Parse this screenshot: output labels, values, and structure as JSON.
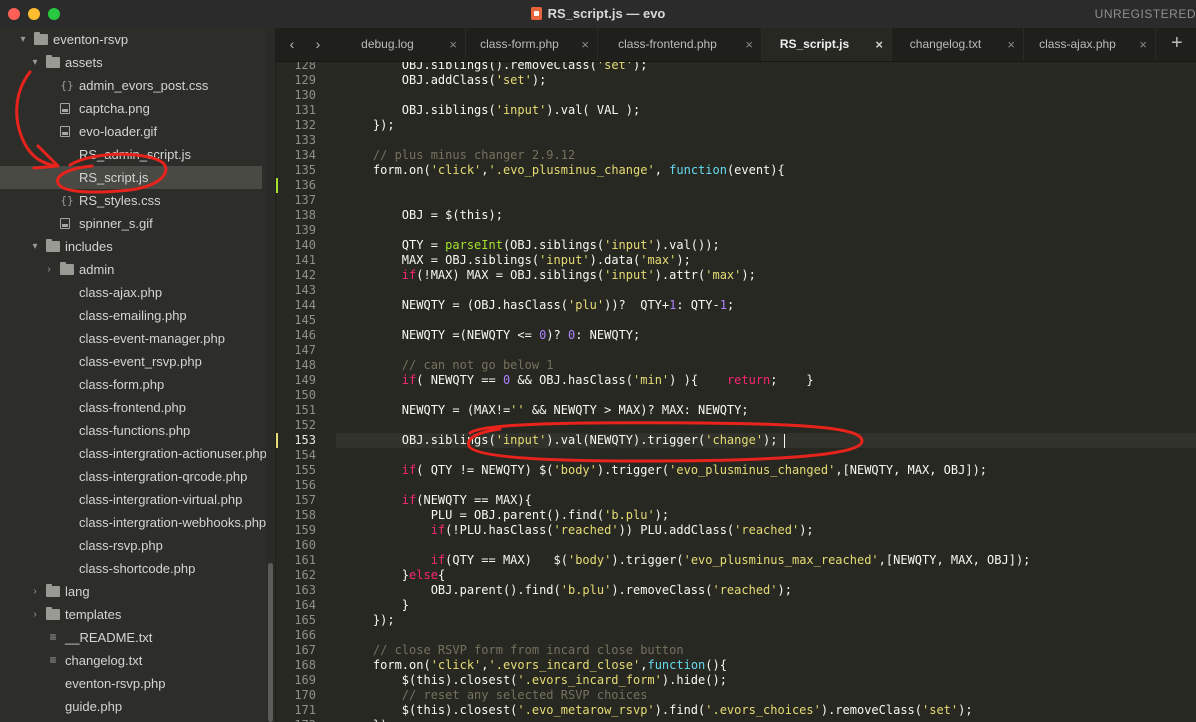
{
  "window": {
    "title": "RS_script.js — evo",
    "unregistered": "UNREGISTERED",
    "accent": "#272822"
  },
  "sidebar": {
    "items": [
      {
        "label": "eventon-rsvp",
        "kind": "folder",
        "depth": 0,
        "expanded": true
      },
      {
        "label": "assets",
        "kind": "folder",
        "depth": 1,
        "expanded": true
      },
      {
        "label": "admin_evors_post.css",
        "kind": "css",
        "depth": 2
      },
      {
        "label": "captcha.png",
        "kind": "image",
        "depth": 2
      },
      {
        "label": "evo-loader.gif",
        "kind": "image",
        "depth": 2
      },
      {
        "label": "RS_admin_script.js",
        "kind": "file",
        "depth": 2
      },
      {
        "label": "RS_script.js",
        "kind": "file",
        "depth": 2,
        "selected": true
      },
      {
        "label": "RS_styles.css",
        "kind": "css",
        "depth": 2
      },
      {
        "label": "spinner_s.gif",
        "kind": "image",
        "depth": 2
      },
      {
        "label": "includes",
        "kind": "folder",
        "depth": 1,
        "expanded": true
      },
      {
        "label": "admin",
        "kind": "folder",
        "depth": 2,
        "expanded": false
      },
      {
        "label": "class-ajax.php",
        "kind": "file",
        "depth": 2
      },
      {
        "label": "class-emailing.php",
        "kind": "file",
        "depth": 2
      },
      {
        "label": "class-event-manager.php",
        "kind": "file",
        "depth": 2
      },
      {
        "label": "class-event_rsvp.php",
        "kind": "file",
        "depth": 2
      },
      {
        "label": "class-form.php",
        "kind": "file",
        "depth": 2
      },
      {
        "label": "class-frontend.php",
        "kind": "file",
        "depth": 2
      },
      {
        "label": "class-functions.php",
        "kind": "file",
        "depth": 2
      },
      {
        "label": "class-intergration-actionuser.php",
        "kind": "file",
        "depth": 2
      },
      {
        "label": "class-intergration-qrcode.php",
        "kind": "file",
        "depth": 2
      },
      {
        "label": "class-intergration-virtual.php",
        "kind": "file",
        "depth": 2
      },
      {
        "label": "class-intergration-webhooks.php",
        "kind": "file",
        "depth": 2
      },
      {
        "label": "class-rsvp.php",
        "kind": "file",
        "depth": 2
      },
      {
        "label": "class-shortcode.php",
        "kind": "file",
        "depth": 2
      },
      {
        "label": "lang",
        "kind": "folder",
        "depth": 1,
        "expanded": false
      },
      {
        "label": "templates",
        "kind": "folder",
        "depth": 1,
        "expanded": false
      },
      {
        "label": "__README.txt",
        "kind": "text",
        "depth": 1
      },
      {
        "label": "changelog.txt",
        "kind": "text",
        "depth": 1
      },
      {
        "label": "eventon-rsvp.php",
        "kind": "file",
        "depth": 1
      },
      {
        "label": "guide.php",
        "kind": "file",
        "depth": 1
      }
    ]
  },
  "tabs": [
    {
      "label": "debug.log",
      "active": false
    },
    {
      "label": "class-form.php",
      "active": false
    },
    {
      "label": "class-frontend.php",
      "active": false
    },
    {
      "label": "RS_script.js",
      "active": true
    },
    {
      "label": "changelog.txt",
      "active": false
    },
    {
      "label": "class-ajax.php",
      "active": false
    }
  ],
  "tabbar": {
    "close_glyph": "×",
    "back_glyph": "‹",
    "forward_glyph": "›",
    "new_tab_glyph": "+"
  },
  "editor": {
    "cursor_line": 153,
    "modified_lines": [
      136,
      153
    ],
    "lines": [
      {
        "n": "128",
        "tokens": [
          [
            "",
            "        OBJ.siblings().removeClass("
          ],
          [
            "st",
            "'set'"
          ],
          [
            "",
            ");"
          ]
        ]
      },
      {
        "n": "129",
        "tokens": [
          [
            "",
            "        OBJ.addClass("
          ],
          [
            "st",
            "'set'"
          ],
          [
            "",
            ");"
          ]
        ]
      },
      {
        "n": "130",
        "tokens": []
      },
      {
        "n": "131",
        "tokens": [
          [
            "",
            "        OBJ.siblings("
          ],
          [
            "st",
            "'input'"
          ],
          [
            "",
            ").val( VAL );"
          ]
        ]
      },
      {
        "n": "132",
        "tokens": [
          [
            "",
            "    });"
          ]
        ]
      },
      {
        "n": "133",
        "tokens": []
      },
      {
        "n": "134",
        "tokens": [
          [
            "cm",
            "    // plus minus changer 2.9.12"
          ]
        ]
      },
      {
        "n": "135",
        "tokens": [
          [
            "",
            "    form.on("
          ],
          [
            "st",
            "'click'"
          ],
          [
            "",
            ","
          ],
          [
            "st",
            "'.evo_plusminus_change'"
          ],
          [
            "",
            ", "
          ],
          [
            "bi",
            "function"
          ],
          [
            "",
            "(event){"
          ]
        ]
      },
      {
        "n": "136",
        "tokens": []
      },
      {
        "n": "137",
        "tokens": []
      },
      {
        "n": "138",
        "tokens": [
          [
            "",
            "        OBJ = $(this);"
          ]
        ]
      },
      {
        "n": "139",
        "tokens": []
      },
      {
        "n": "140",
        "tokens": [
          [
            "",
            "        QTY = "
          ],
          [
            "fn",
            "parseInt"
          ],
          [
            "",
            "(OBJ.siblings("
          ],
          [
            "st",
            "'input'"
          ],
          [
            "",
            ").val());"
          ]
        ]
      },
      {
        "n": "141",
        "tokens": [
          [
            "",
            "        MAX = OBJ.siblings("
          ],
          [
            "st",
            "'input'"
          ],
          [
            "",
            ").data("
          ],
          [
            "st",
            "'max'"
          ],
          [
            "",
            ");"
          ]
        ]
      },
      {
        "n": "142",
        "tokens": [
          [
            "",
            "        "
          ],
          [
            "kw",
            "if"
          ],
          [
            "",
            "(!MAX) MAX = OBJ.siblings("
          ],
          [
            "st",
            "'input'"
          ],
          [
            "",
            ").attr("
          ],
          [
            "st",
            "'max'"
          ],
          [
            "",
            ");"
          ]
        ]
      },
      {
        "n": "143",
        "tokens": []
      },
      {
        "n": "144",
        "tokens": [
          [
            "",
            "        NEWQTY = (OBJ.hasClass("
          ],
          [
            "st",
            "'plu'"
          ],
          [
            "",
            "))?  QTY+"
          ],
          [
            "nm",
            "1"
          ],
          [
            "",
            ": QTY-"
          ],
          [
            "nm",
            "1"
          ],
          [
            "",
            ";"
          ]
        ]
      },
      {
        "n": "145",
        "tokens": []
      },
      {
        "n": "146",
        "tokens": [
          [
            "",
            "        NEWQTY =(NEWQTY <= "
          ],
          [
            "nm",
            "0"
          ],
          [
            "",
            ")? "
          ],
          [
            "nm",
            "0"
          ],
          [
            "",
            ": NEWQTY;"
          ]
        ]
      },
      {
        "n": "147",
        "tokens": []
      },
      {
        "n": "148",
        "tokens": [
          [
            "cm",
            "        // can not go below 1"
          ]
        ]
      },
      {
        "n": "149",
        "tokens": [
          [
            "",
            "        "
          ],
          [
            "kw",
            "if"
          ],
          [
            "",
            "( NEWQTY == "
          ],
          [
            "nm",
            "0"
          ],
          [
            "",
            " && OBJ.hasClass("
          ],
          [
            "st",
            "'min'"
          ],
          [
            "",
            ") ){    "
          ],
          [
            "kw",
            "return"
          ],
          [
            "",
            ";    }"
          ]
        ]
      },
      {
        "n": "150",
        "tokens": []
      },
      {
        "n": "151",
        "tokens": [
          [
            "",
            "        NEWQTY = (MAX!="
          ],
          [
            "st",
            "''"
          ],
          [
            "",
            " && NEWQTY > MAX)? MAX: NEWQTY;"
          ]
        ]
      },
      {
        "n": "152",
        "tokens": []
      },
      {
        "n": "153",
        "tokens": [
          [
            "",
            "        OBJ.siblings("
          ],
          [
            "st",
            "'input'"
          ],
          [
            "",
            ").val(NEWQTY).trigger("
          ],
          [
            "st",
            "'change'"
          ],
          [
            "",
            ");"
          ]
        ]
      },
      {
        "n": "154",
        "tokens": []
      },
      {
        "n": "155",
        "tokens": [
          [
            "",
            "        "
          ],
          [
            "kw",
            "if"
          ],
          [
            "",
            "( QTY != NEWQTY) $("
          ],
          [
            "st",
            "'body'"
          ],
          [
            "",
            ").trigger("
          ],
          [
            "st",
            "'evo_plusminus_changed'"
          ],
          [
            "",
            ",[NEWQTY, MAX, OBJ]);"
          ]
        ]
      },
      {
        "n": "156",
        "tokens": []
      },
      {
        "n": "157",
        "tokens": [
          [
            "",
            "        "
          ],
          [
            "kw",
            "if"
          ],
          [
            "",
            "(NEWQTY == MAX){"
          ]
        ]
      },
      {
        "n": "158",
        "tokens": [
          [
            "",
            "            PLU = OBJ.parent().find("
          ],
          [
            "st",
            "'b.plu'"
          ],
          [
            "",
            ");"
          ]
        ]
      },
      {
        "n": "159",
        "tokens": [
          [
            "",
            "            "
          ],
          [
            "kw",
            "if"
          ],
          [
            "",
            "(!PLU.hasClass("
          ],
          [
            "st",
            "'reached'"
          ],
          [
            "",
            ")) PLU.addClass("
          ],
          [
            "st",
            "'reached'"
          ],
          [
            "",
            ");"
          ]
        ]
      },
      {
        "n": "160",
        "tokens": []
      },
      {
        "n": "161",
        "tokens": [
          [
            "",
            "            "
          ],
          [
            "kw",
            "if"
          ],
          [
            "",
            "(QTY == MAX)   $("
          ],
          [
            "st",
            "'body'"
          ],
          [
            "",
            ").trigger("
          ],
          [
            "st",
            "'evo_plusminus_max_reached'"
          ],
          [
            "",
            ",[NEWQTY, MAX, OBJ]);"
          ]
        ]
      },
      {
        "n": "162",
        "tokens": [
          [
            "",
            "        }"
          ],
          [
            "kw",
            "else"
          ],
          [
            "",
            "{"
          ]
        ]
      },
      {
        "n": "163",
        "tokens": [
          [
            "",
            "            OBJ.parent().find("
          ],
          [
            "st",
            "'b.plu'"
          ],
          [
            "",
            ").removeClass("
          ],
          [
            "st",
            "'reached'"
          ],
          [
            "",
            ");"
          ]
        ]
      },
      {
        "n": "164",
        "tokens": [
          [
            "",
            "        }"
          ]
        ]
      },
      {
        "n": "165",
        "tokens": [
          [
            "",
            "    });"
          ]
        ]
      },
      {
        "n": "166",
        "tokens": []
      },
      {
        "n": "167",
        "tokens": [
          [
            "cm",
            "    // close RSVP form from incard close button"
          ]
        ]
      },
      {
        "n": "168",
        "tokens": [
          [
            "",
            "    form.on("
          ],
          [
            "st",
            "'click'"
          ],
          [
            "",
            ","
          ],
          [
            "st",
            "'.evors_incard_close'"
          ],
          [
            "",
            ","
          ],
          [
            "bi",
            "function"
          ],
          [
            "",
            "(){"
          ]
        ]
      },
      {
        "n": "169",
        "tokens": [
          [
            "",
            "        $(this).closest("
          ],
          [
            "st",
            "'.evors_incard_form'"
          ],
          [
            "",
            ").hide();"
          ]
        ]
      },
      {
        "n": "170",
        "tokens": [
          [
            "cm",
            "        // reset any selected RSVP choices"
          ]
        ]
      },
      {
        "n": "171",
        "tokens": [
          [
            "",
            "        $(this).closest("
          ],
          [
            "st",
            "'.evo_metarow_rsvp'"
          ],
          [
            "",
            ").find("
          ],
          [
            "st",
            "'.evors_choices'"
          ],
          [
            "",
            ").removeClass("
          ],
          [
            "st",
            "'set'"
          ],
          [
            "",
            ");"
          ]
        ]
      },
      {
        "n": "172",
        "tokens": [
          [
            "",
            "    });"
          ]
        ]
      }
    ]
  },
  "annotation_color": "#e8231c"
}
